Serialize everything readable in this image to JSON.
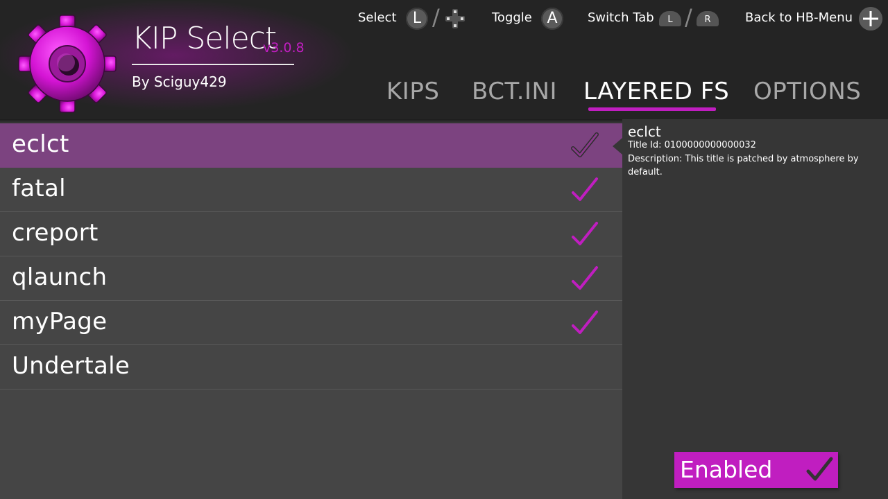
{
  "app": {
    "title": "KIP Select",
    "version": "v3.0.8",
    "author": "By Sciguy429"
  },
  "hints": {
    "select": "Select",
    "select_button": "L",
    "toggle": "Toggle",
    "toggle_button": "A",
    "switch_tab": "Switch Tab",
    "switch_tab_left": "L",
    "switch_tab_right": "R",
    "back": "Back to HB-Menu"
  },
  "tabs": [
    {
      "label": "KIPS",
      "active": false
    },
    {
      "label": "BCT.INI",
      "active": false
    },
    {
      "label": "LAYERED FS",
      "active": true
    },
    {
      "label": "OPTIONS",
      "active": false
    }
  ],
  "list": [
    {
      "name": "eclct",
      "checked": true,
      "selected": true
    },
    {
      "name": "fatal",
      "checked": true,
      "selected": false
    },
    {
      "name": "creport",
      "checked": true,
      "selected": false
    },
    {
      "name": "qlaunch",
      "checked": true,
      "selected": false
    },
    {
      "name": "myPage",
      "checked": true,
      "selected": false
    },
    {
      "name": "Undertale",
      "checked": false,
      "selected": false
    }
  ],
  "detail": {
    "name": "eclct",
    "title_id": "Title Id: 0100000000000032",
    "description": "Description: This title is patched by atmosphere by default."
  },
  "status_button": {
    "label": "Enabled",
    "icon": "check-icon"
  },
  "colors": {
    "accent": "#c01ec0",
    "selected_row": "#7c4380",
    "background": "#454545",
    "header": "#242424",
    "detail_pane": "#363636"
  }
}
